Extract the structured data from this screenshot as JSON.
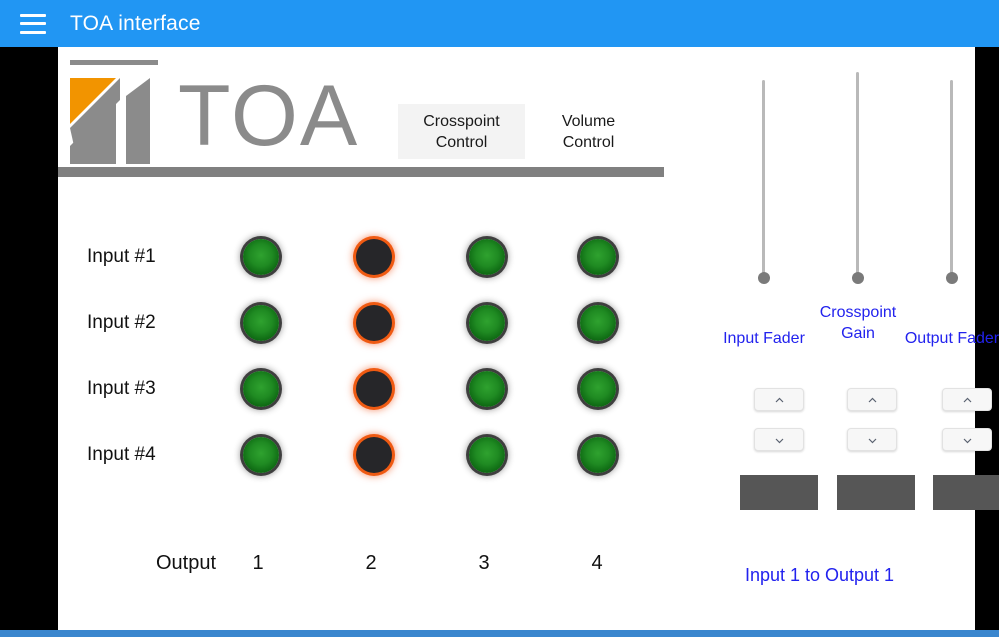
{
  "appbar": {
    "menu_icon": "hamburger-menu-icon",
    "title": "TOA interface",
    "background_color": "#2196f3"
  },
  "brand": {
    "wordmark": "TOA",
    "logo_icon": "toa-logo-icon",
    "accent_color": "#f29400",
    "gray_color": "#8b8b8b"
  },
  "tabs": [
    {
      "line1": "Crosspoint",
      "line2": "Control",
      "active": true
    },
    {
      "line1": "Volume",
      "line2": "Control",
      "active": false
    }
  ],
  "matrix": {
    "input_labels": [
      "Input #1",
      "Input #2",
      "Input #3",
      "Input #4"
    ],
    "output_word": "Output",
    "output_labels": [
      "1",
      "2",
      "3",
      "4"
    ],
    "states": [
      [
        "on",
        "off",
        "on",
        "on"
      ],
      [
        "on",
        "off",
        "on",
        "on"
      ],
      [
        "on",
        "off",
        "on",
        "on"
      ],
      [
        "on",
        "off",
        "on",
        "on"
      ]
    ],
    "on_color": "#1f8a22",
    "off_color": "#262629",
    "off_ring_color": "#ef5a12"
  },
  "controls": {
    "sliders": [
      {
        "label_line1": "Input Fader",
        "label_line2": "",
        "value": 0
      },
      {
        "label_line1": "Crosspoint",
        "label_line2": "Gain",
        "value": 0
      },
      {
        "label_line1": "Output Fader",
        "label_line2": "",
        "value": 0
      }
    ],
    "stepper_up_icon": "chevron-up-icon",
    "stepper_down_icon": "chevron-down-icon",
    "readouts": [
      "",
      "",
      ""
    ],
    "label_color": "#2222ee",
    "readout_color": "#565656"
  },
  "status": {
    "route_text": "Input 1 to Output 1"
  }
}
